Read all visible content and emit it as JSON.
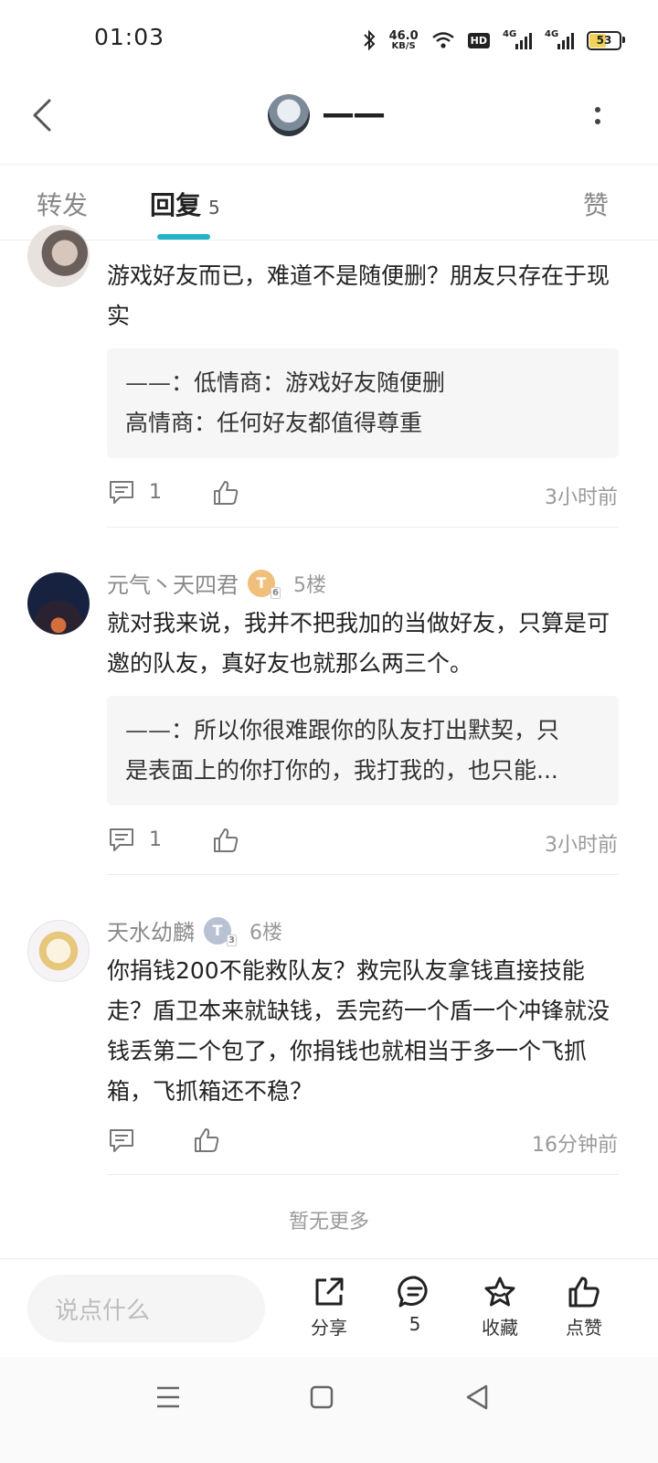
{
  "status_bar": {
    "time": "01:03",
    "net_speed": "46.0",
    "net_unit": "KB/S",
    "hd": "HD",
    "signal_label": "4G",
    "battery": "53"
  },
  "header": {
    "username": "——"
  },
  "tabs": [
    {
      "label": "转发"
    },
    {
      "label": "回复",
      "count": "5"
    },
    {
      "label": "赞"
    }
  ],
  "comments": [
    {
      "username": "",
      "floor": "",
      "text": "游戏好友而已，难道不是随便删？朋友只存在于现实",
      "reply": {
        "name": "——",
        "text_line1": "：低情商：游戏好友随便删",
        "text_line2": "高情商：任何好友都值得尊重"
      },
      "reply_count": "1",
      "time": "3小时前"
    },
    {
      "username": "元气丶天四君",
      "medal": "T",
      "medal_level": "6",
      "floor": "5楼",
      "text": "就对我来说，我并不把我加的当做好友，只算是可邀的队友，真好友也就那么两三个。",
      "reply": {
        "name": "——",
        "text_line1": "：所以你很难跟你的队友打出默契，只",
        "text_line2": "是表面上的你打你的，我打我的，也只能..."
      },
      "reply_count": "1",
      "time": "3小时前"
    },
    {
      "username": "天水幼麟",
      "medal": "T",
      "medal_level": "3",
      "floor": "6楼",
      "text": "你捐钱200不能救队友？救完队友拿钱直接技能走？盾卫本来就缺钱，丢完药一个盾一个冲锋就没钱丢第二个包了，你捐钱也就相当于多一个飞抓箱，飞抓箱还不稳？",
      "reply_count": "",
      "time": "16分钟前"
    }
  ],
  "footer_note": "暂无更多",
  "bottom_bar": {
    "input_placeholder": "说点什么",
    "share_label": "分享",
    "comment_count": "5",
    "collect_label": "收藏",
    "like_label": "点赞"
  }
}
